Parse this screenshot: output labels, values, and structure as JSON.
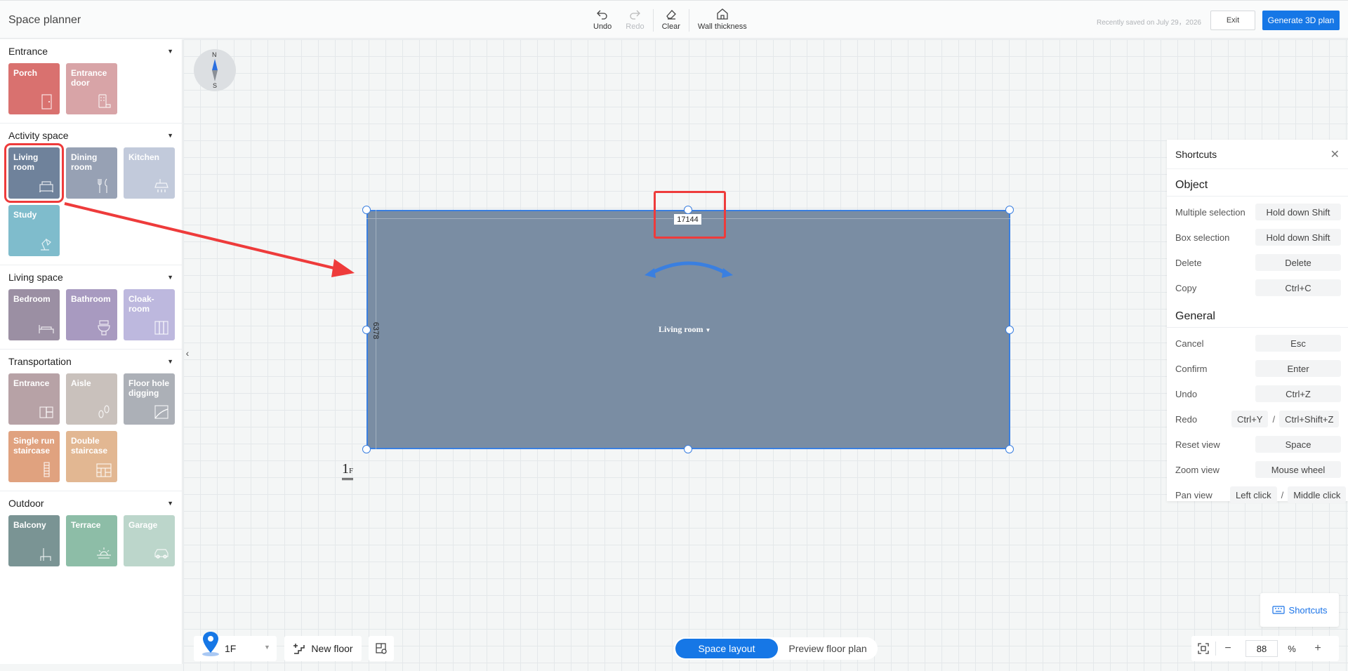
{
  "header": {
    "title": "Space planner",
    "tools": {
      "undo": "Undo",
      "redo": "Redo",
      "clear": "Clear",
      "wall_thickness": "Wall thickness"
    },
    "saved_note": "Recently saved on July 29，2026",
    "exit_label": "Exit",
    "generate_label": "Generate 3D plan"
  },
  "sidebar": {
    "sections": [
      {
        "title": "Entrance",
        "tiles": [
          {
            "label": "Porch",
            "color": "#d9716f",
            "icon": "door-icon"
          },
          {
            "label": "Entrance door",
            "color": "#d8a4a7",
            "icon": "keypad-lock-icon"
          }
        ]
      },
      {
        "title": "Activity space",
        "tiles": [
          {
            "label": "Living room",
            "color": "#6f829b",
            "icon": "sofa-icon"
          },
          {
            "label": "Dining room",
            "color": "#97a1b4",
            "icon": "fork-knife-icon"
          },
          {
            "label": "Kitchen",
            "color": "#c2cadb",
            "icon": "range-hood-icon"
          },
          {
            "label": "Study",
            "color": "#7fbccc",
            "icon": "desk-lamp-icon"
          }
        ]
      },
      {
        "title": "Living space",
        "tiles": [
          {
            "label": "Bedroom",
            "color": "#9b8fa3",
            "icon": "bed-icon"
          },
          {
            "label": "Bathroom",
            "color": "#a89ac0",
            "icon": "toilet-icon"
          },
          {
            "label": "Cloak-room",
            "color": "#bdb8de",
            "icon": "wardrobe-icon"
          }
        ]
      },
      {
        "title": "Transportation",
        "tiles": [
          {
            "label": "Entrance",
            "color": "#b7a2a6",
            "icon": "entrance-icon"
          },
          {
            "label": "Aisle",
            "color": "#c9c1bc",
            "icon": "footprints-icon"
          },
          {
            "label": "Floor hole digging",
            "color": "#acb0b7",
            "icon": "floor-hole-icon"
          },
          {
            "label": "Single run staircase",
            "color": "#e0a27f",
            "icon": "straight-stairs-icon"
          },
          {
            "label": "Double staircase",
            "color": "#e2b792",
            "icon": "double-stairs-icon"
          }
        ]
      },
      {
        "title": "Outdoor",
        "tiles": [
          {
            "label": "Balcony",
            "color": "#7a9494",
            "icon": "balcony-chair-icon"
          },
          {
            "label": "Terrace",
            "color": "#8dbda7",
            "icon": "sun-terrace-icon"
          },
          {
            "label": "Garage",
            "color": "#bcd6cb",
            "icon": "car-icon"
          }
        ]
      }
    ]
  },
  "canvas": {
    "compass": {
      "north": "N",
      "south": "S"
    },
    "room": {
      "label": "Living room",
      "width_value": "17144",
      "height_value": "6378",
      "fill": "#7a8da3"
    },
    "floor_mark": {
      "number": "1",
      "suffix": "F"
    }
  },
  "shortcuts": {
    "title": "Shortcuts",
    "groups": [
      {
        "title": "Object",
        "rows": [
          {
            "label": "Multiple selection",
            "keys": [
              "Hold down Shift"
            ]
          },
          {
            "label": "Box selection",
            "keys": [
              "Hold down Shift"
            ]
          },
          {
            "label": "Delete",
            "keys": [
              "Delete"
            ]
          },
          {
            "label": "Copy",
            "keys": [
              "Ctrl+C"
            ]
          }
        ]
      },
      {
        "title": "General",
        "rows": [
          {
            "label": "Cancel",
            "keys": [
              "Esc"
            ]
          },
          {
            "label": "Confirm",
            "keys": [
              "Enter"
            ]
          },
          {
            "label": "Undo",
            "keys": [
              "Ctrl+Z"
            ]
          },
          {
            "label": "Redo",
            "keys": [
              "Ctrl+Y",
              "Ctrl+Shift+Z"
            ]
          },
          {
            "label": "Reset view",
            "keys": [
              "Space"
            ]
          },
          {
            "label": "Zoom view",
            "keys": [
              "Mouse wheel"
            ]
          },
          {
            "label": "Pan view",
            "keys": [
              "Left click",
              "Middle click"
            ]
          }
        ]
      }
    ],
    "toggle_label": "Shortcuts"
  },
  "bottom": {
    "floor_name": "1F",
    "new_floor_label": "New floor",
    "mode_active": "Space layout",
    "mode_inactive": "Preview floor plan",
    "zoom_value": "88",
    "zoom_unit": "%"
  },
  "colors": {
    "accent": "#1677e6",
    "highlight": "#ee3b3b",
    "selection": "#3a7fe0"
  }
}
